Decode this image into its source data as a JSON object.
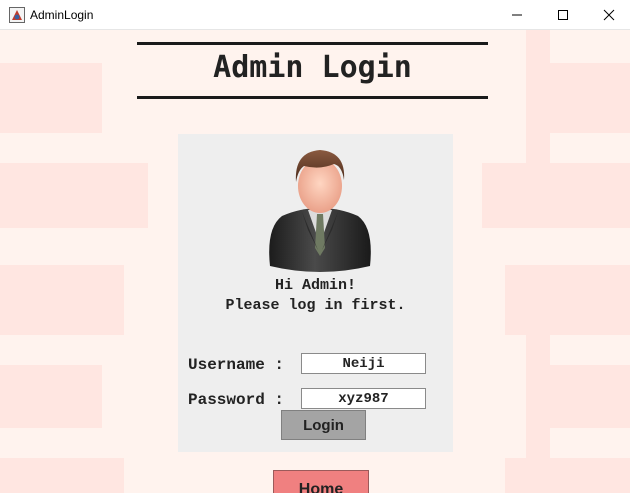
{
  "window": {
    "title": "AdminLogin",
    "app_icon": "java-icon",
    "controls": [
      "minimize-icon",
      "maximize-icon",
      "close-icon"
    ]
  },
  "page": {
    "title": "Admin Login"
  },
  "login_panel": {
    "avatar_icon": "admin-avatar-icon",
    "greeting_line1": "Hi Admin!",
    "greeting_line2": "Please log in first.",
    "username_label": "Username :",
    "username_value": "Neiji",
    "password_label": "Password :",
    "password_value": "xyz987",
    "login_label": "Login"
  },
  "home_label": "Home",
  "colors": {
    "background": "#ffe6e1",
    "background_light": "#fff3ee",
    "panel": "#eeeeee",
    "login_button": "#a4a4a4",
    "home_button": "#f08080"
  }
}
